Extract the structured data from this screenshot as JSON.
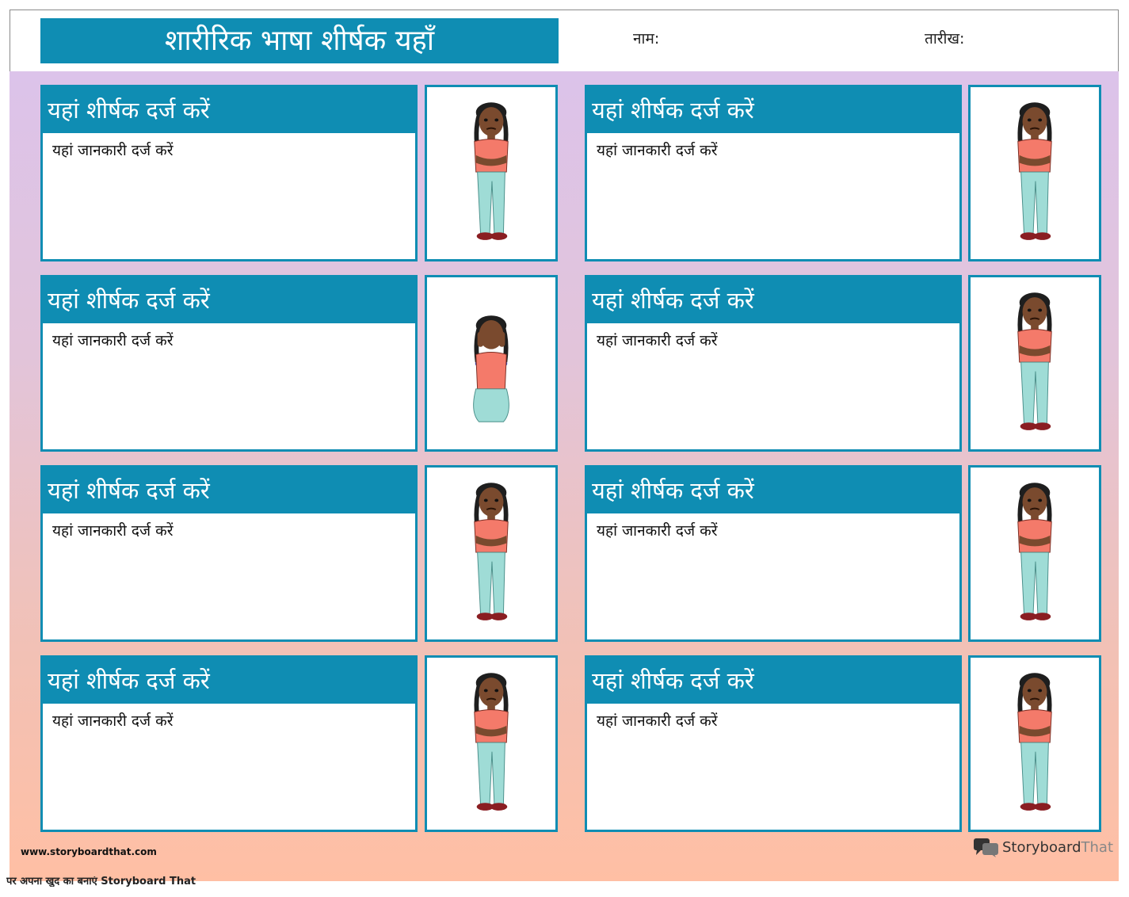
{
  "header": {
    "title": "शारीरिक भाषा शीर्षक यहाँ",
    "name_label": "नाम:",
    "date_label": "तारीख:"
  },
  "cards": [
    {
      "title": "यहां शीर्षक दर्ज करें",
      "body": "यहां जानकारी दर्ज करें"
    },
    {
      "title": "यहां शीर्षक दर्ज करें",
      "body": "यहां जानकारी दर्ज करें"
    },
    {
      "title": "यहां शीर्षक दर्ज करें",
      "body": "यहां जानकारी दर्ज करें"
    },
    {
      "title": "यहां शीर्षक दर्ज करें",
      "body": "यहां जानकारी दर्ज करें"
    },
    {
      "title": "यहां शीर्षक दर्ज करें",
      "body": "यहां जानकारी दर्ज करें"
    },
    {
      "title": "यहां शीर्षक दर्ज करें",
      "body": "यहां जानकारी दर्ज करें"
    },
    {
      "title": "यहां शीर्षक दर्ज करें",
      "body": "यहां जानकारी दर्ज करें"
    },
    {
      "title": "यहां शीर्षक दर्ज करें",
      "body": "यहां जानकारी दर्ज करें"
    }
  ],
  "figures": [
    {
      "icon": "girl-arms-crossed-crying",
      "pose": "standing"
    },
    {
      "icon": "girl-hand-on-cheek",
      "pose": "standing"
    },
    {
      "icon": "girl-kneeling-hands-on-face",
      "pose": "kneeling"
    },
    {
      "icon": "girl-arms-crossed-sad",
      "pose": "standing"
    },
    {
      "icon": "girl-arms-crossed-eyes-closed",
      "pose": "standing"
    },
    {
      "icon": "girl-angry-hands-at-sides",
      "pose": "standing"
    },
    {
      "icon": "girl-arms-crossed-smirk",
      "pose": "standing"
    },
    {
      "icon": "girl-hands-on-face-knock-kneed",
      "pose": "standing"
    }
  ],
  "footer": {
    "url": "www.storyboardthat.com",
    "logo_main": "Storyboard",
    "logo_light": "That",
    "credit": "पर अपना खुद का बनाएं Storyboard That"
  },
  "colors": {
    "accent": "#0f8db3",
    "gradient_top": "#dcc3ea",
    "gradient_bottom": "#ffbfa4",
    "shirt": "#f47a6a",
    "pants": "#9fdcd6",
    "skin": "#7a4a2e",
    "hair": "#1e1e1e"
  }
}
